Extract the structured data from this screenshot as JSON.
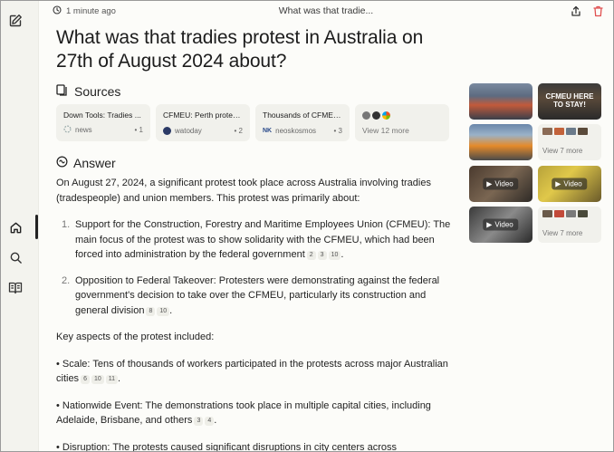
{
  "header": {
    "timestamp": "1 minute ago",
    "title": "What was that tradie..."
  },
  "question": "What was that tradies protest in Australia on 27th of August 2024 about?",
  "sources": {
    "heading": "Sources",
    "cards": [
      {
        "title": "Down Tools: Tradies ...",
        "site": "news",
        "num": "1"
      },
      {
        "title": "CFMEU: Perth protes...",
        "site": "watoday",
        "num": "2"
      },
      {
        "title": "Thousands of CFMEU...",
        "site": "neoskosmos",
        "num": "3"
      }
    ],
    "view_more": "View 12 more"
  },
  "answer": {
    "heading": "Answer",
    "intro": "On August 27, 2024, a significant protest took place across Australia involving tradies (tradespeople) and union members. This protest was primarily about:",
    "points": [
      {
        "num": "1.",
        "text": "Support for the Construction, Forestry and Maritime Employees Union (CFMEU): The main focus of the protest was to show solidarity with the CFMEU, which had been forced into administration by the federal government",
        "cites": [
          "2",
          "3",
          "10"
        ]
      },
      {
        "num": "2.",
        "text": "Opposition to Federal Takeover: Protesters were demonstrating against the federal government's decision to take over the CFMEU, particularly its construction and general division",
        "cites": [
          "8",
          "10"
        ]
      }
    ],
    "aspects_intro": "Key aspects of the protest included:",
    "aspects": [
      {
        "text": "• Scale: Tens of thousands of workers participated in the protests across major Australian cities",
        "cites": [
          "6",
          "10",
          "11"
        ]
      },
      {
        "text": "• Nationwide Event: The demonstrations took place in multiple capital cities, including Adelaide, Brisbane, and others",
        "cites": [
          "3",
          "4"
        ]
      },
      {
        "text": "• Disruption: The protests caused significant disruptions in city centers across",
        "cites": []
      }
    ]
  },
  "media": {
    "video_label": "Video",
    "view_more_1": "View 7 more",
    "view_more_2": "View 7 more",
    "image_sign_text": "CFMEU HERE TO STAY!"
  }
}
